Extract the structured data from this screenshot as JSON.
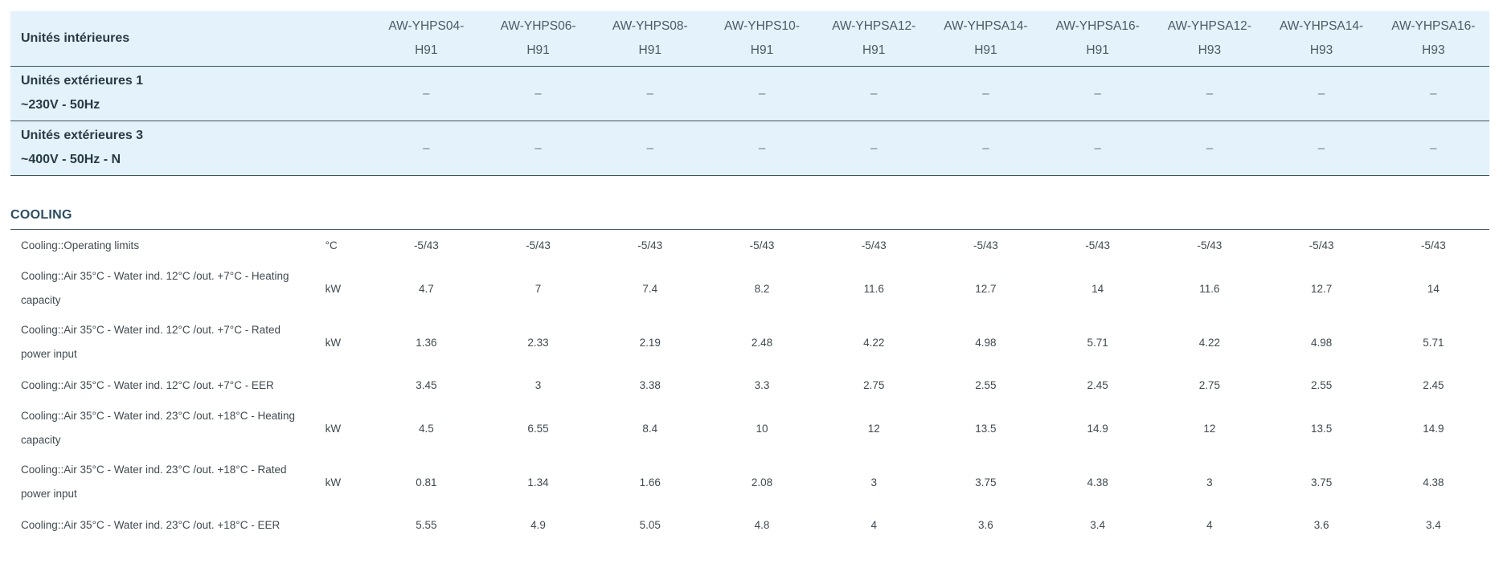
{
  "header": {
    "indoor_label": "Unités intérieures",
    "models": [
      [
        "AW-YHPS04-",
        "H91"
      ],
      [
        "AW-YHPS06-",
        "H91"
      ],
      [
        "AW-YHPS08-",
        "H91"
      ],
      [
        "AW-YHPS10-",
        "H91"
      ],
      [
        "AW-YHPSA12-",
        "H91"
      ],
      [
        "AW-YHPSA14-",
        "H91"
      ],
      [
        "AW-YHPSA16-",
        "H91"
      ],
      [
        "AW-YHPSA12-",
        "H93"
      ],
      [
        "AW-YHPSA14-",
        "H93"
      ],
      [
        "AW-YHPSA16-",
        "H93"
      ]
    ],
    "outdoor_rows": [
      {
        "line1": "Unités extérieures 1",
        "line2": "~230V - 50Hz",
        "values": [
          "–",
          "–",
          "–",
          "–",
          "–",
          "–",
          "–",
          "–",
          "–",
          "–"
        ]
      },
      {
        "line1": "Unités extérieures 3",
        "line2": "~400V - 50Hz - N",
        "values": [
          "–",
          "–",
          "–",
          "–",
          "–",
          "–",
          "–",
          "–",
          "–",
          "–"
        ]
      }
    ]
  },
  "section": {
    "title": "COOLING"
  },
  "specs": [
    {
      "name": [
        "Cooling::Operating limits"
      ],
      "unit": "°C",
      "values": [
        "-5/43",
        "-5/43",
        "-5/43",
        "-5/43",
        "-5/43",
        "-5/43",
        "-5/43",
        "-5/43",
        "-5/43",
        "-5/43"
      ]
    },
    {
      "name": [
        "Cooling::Air 35°C - Water ind. 12°C /out. +7°C - Heating",
        "capacity"
      ],
      "unit": "kW",
      "values": [
        "4.7",
        "7",
        "7.4",
        "8.2",
        "11.6",
        "12.7",
        "14",
        "11.6",
        "12.7",
        "14"
      ]
    },
    {
      "name": [
        "Cooling::Air 35°C - Water ind. 12°C /out. +7°C - Rated",
        "power input"
      ],
      "unit": "kW",
      "values": [
        "1.36",
        "2.33",
        "2.19",
        "2.48",
        "4.22",
        "4.98",
        "5.71",
        "4.22",
        "4.98",
        "5.71"
      ]
    },
    {
      "name": [
        "Cooling::Air 35°C - Water ind. 12°C /out. +7°C - EER"
      ],
      "unit": "",
      "values": [
        "3.45",
        "3",
        "3.38",
        "3.3",
        "2.75",
        "2.55",
        "2.45",
        "2.75",
        "2.55",
        "2.45"
      ]
    },
    {
      "name": [
        "Cooling::Air 35°C - Water ind. 23°C /out. +18°C - Heating",
        "capacity"
      ],
      "unit": "kW",
      "values": [
        "4.5",
        "6.55",
        "8.4",
        "10",
        "12",
        "13.5",
        "14.9",
        "12",
        "13.5",
        "14.9"
      ]
    },
    {
      "name": [
        "Cooling::Air 35°C - Water ind. 23°C /out. +18°C - Rated",
        "power input"
      ],
      "unit": "kW",
      "values": [
        "0.81",
        "1.34",
        "1.66",
        "2.08",
        "3",
        "3.75",
        "4.38",
        "3",
        "3.75",
        "4.38"
      ]
    },
    {
      "name": [
        "Cooling::Air 35°C - Water ind. 23°C /out. +18°C - EER"
      ],
      "unit": "",
      "values": [
        "5.55",
        "4.9",
        "5.05",
        "4.8",
        "4",
        "3.6",
        "3.4",
        "4",
        "3.6",
        "3.4"
      ]
    }
  ]
}
